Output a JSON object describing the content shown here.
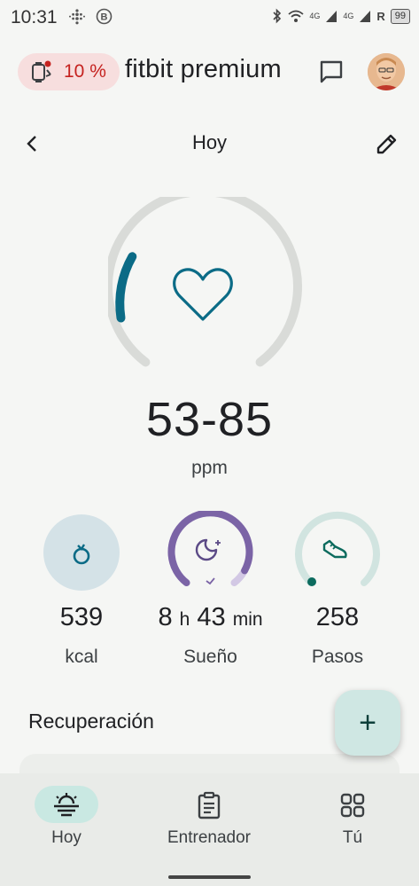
{
  "status_bar": {
    "time": "10:31",
    "net_4g_1": "4G",
    "net_4g_2": "4G",
    "roaming": "R",
    "battery": "99"
  },
  "header": {
    "device_battery": "10 %",
    "brand": "fitbit premium"
  },
  "nav": {
    "title": "Hoy"
  },
  "heart_rate": {
    "range": "53-85",
    "unit": "ppm"
  },
  "metrics": [
    {
      "value": "539",
      "label": "kcal"
    },
    {
      "hours": "8",
      "h_unit": "h",
      "minutes": "43",
      "min_unit": "min",
      "label": "Sueño"
    },
    {
      "value": "258",
      "label": "Pasos"
    }
  ],
  "section": {
    "title": "Recuperación",
    "fab_label": "+"
  },
  "bottom_nav": [
    {
      "label": "Hoy"
    },
    {
      "label": "Entrenador"
    },
    {
      "label": "Tú"
    }
  ],
  "colors": {
    "accent_teal": "#0b6b86",
    "sleep_purple": "#7b64a6",
    "steps_teal": "#0c6b5e",
    "alert_red": "#c5221f"
  }
}
